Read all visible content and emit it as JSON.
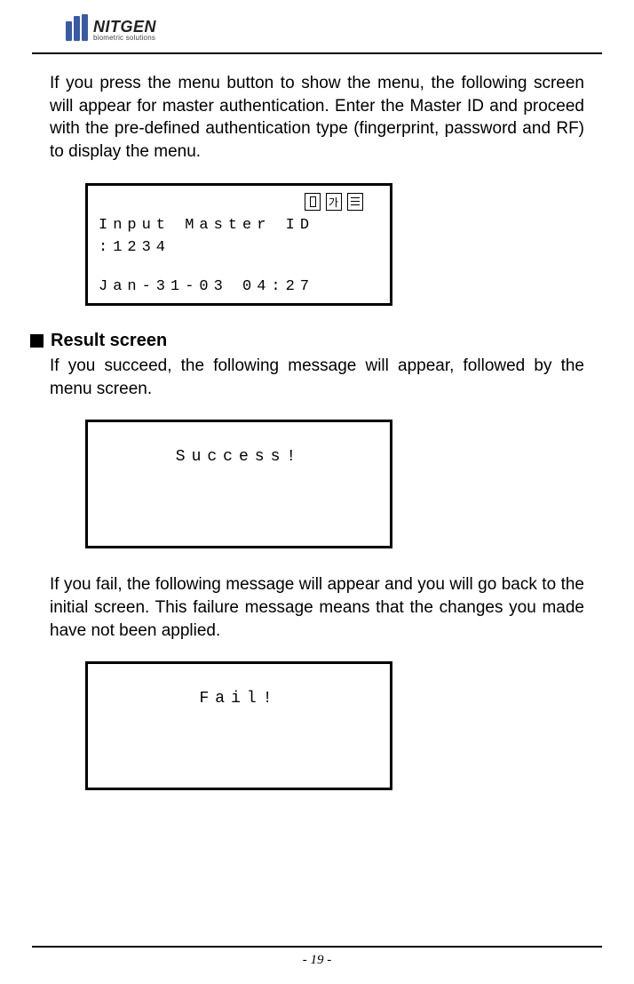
{
  "header": {
    "logo_main": "NITGEN",
    "logo_sub": "biometric solutions"
  },
  "section1": {
    "paragraph": "If you press the menu button to show the menu, the following screen will appear for master authentication. Enter the Master ID and proceed with the pre-defined authentication type (fingerprint, password and RF) to display the menu.",
    "lcd": {
      "line1": "Input Master ID",
      "line2": ":1234",
      "line3": "Jan-31-03 04:27"
    }
  },
  "section2": {
    "heading": "Result screen",
    "paragraph1": "If you succeed, the following message will appear, followed by the menu screen.",
    "lcd_success": "Success!",
    "paragraph2": "If you fail, the following message will appear and you will go back to the initial screen. This failure message means that the changes you made have not been applied.",
    "lcd_fail": "Fail!"
  },
  "footer": {
    "page": "- 19 -"
  }
}
